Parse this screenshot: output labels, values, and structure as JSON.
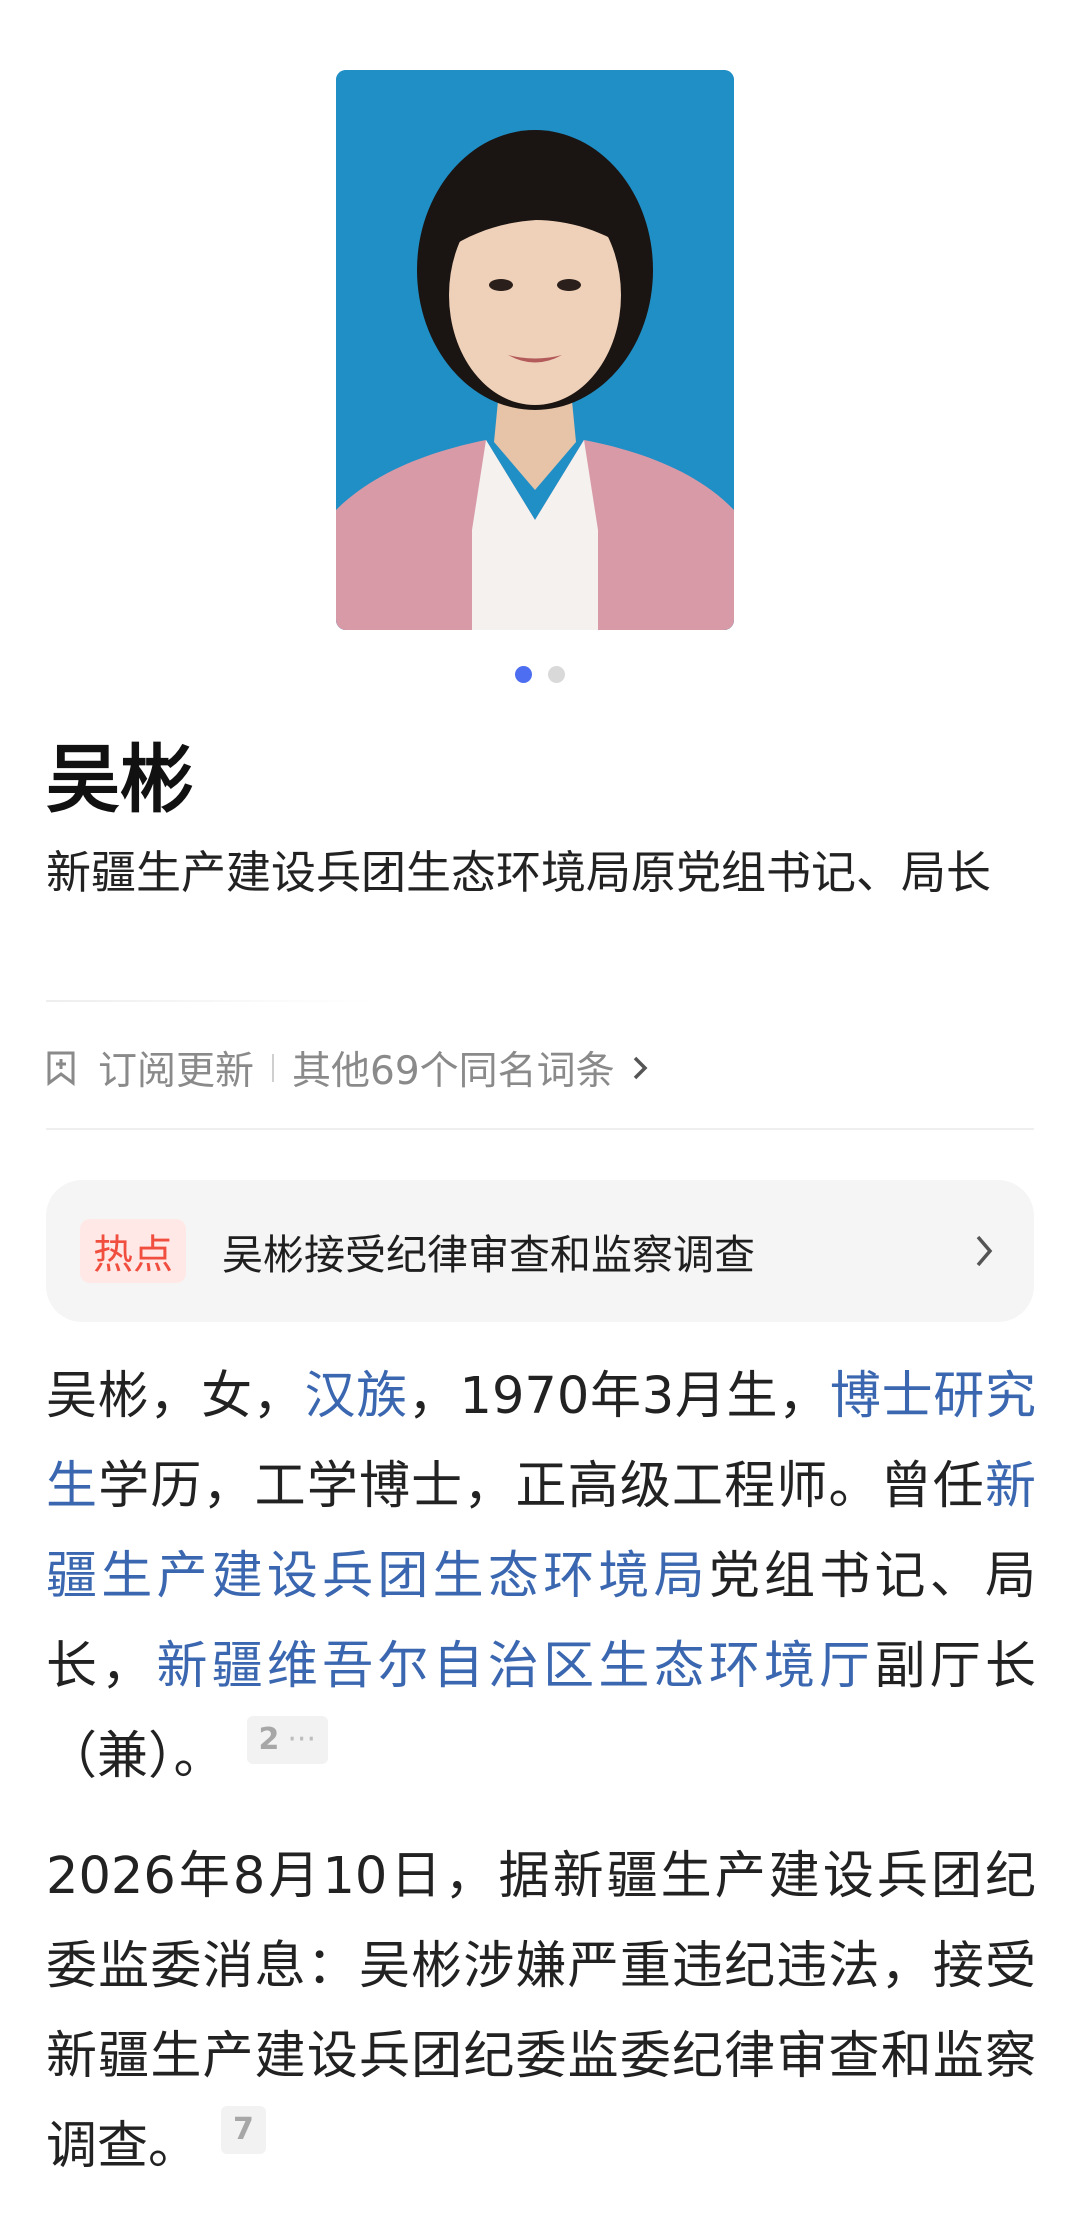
{
  "carousel": {
    "pages": 2,
    "current": 1
  },
  "person": {
    "name": "吴彬",
    "summary": "新疆生产建设兵团生态环境局原党组书记、局长"
  },
  "actions": {
    "subscribe_label": "订阅更新",
    "homonym_label": "其他69个同名词条"
  },
  "hot": {
    "badge": "热点",
    "text": "吴彬接受纪律审查和监察调查"
  },
  "intro": {
    "s1": "吴彬，女，",
    "l1": "汉族",
    "s2": "，1970年3月生，",
    "l2": "博士研究生",
    "s3": "学历，工学博士，正高级工程师。曾任",
    "l3": "新疆生产建设兵团生态环境局",
    "s4": "党组书记、局长，",
    "l4": "新疆维吾尔自治区生态环境厅",
    "s5": "副厅长（兼）。",
    "ref": "2",
    "ref_more": "···"
  },
  "news": {
    "text": "2026年8月10日，据新疆生产建设兵团纪委监委消息：吴彬涉嫌严重违纪违法，接受新疆生产建设兵团纪委监委纪律审查和监察调查。",
    "ref": "7"
  },
  "colors": {
    "accent": "#4e6ef2",
    "link": "#3a67b0",
    "hot_badge_text": "#f04e3e",
    "hot_badge_bg": "#ffe8e6",
    "photo_bg": "#1f8fc6"
  }
}
